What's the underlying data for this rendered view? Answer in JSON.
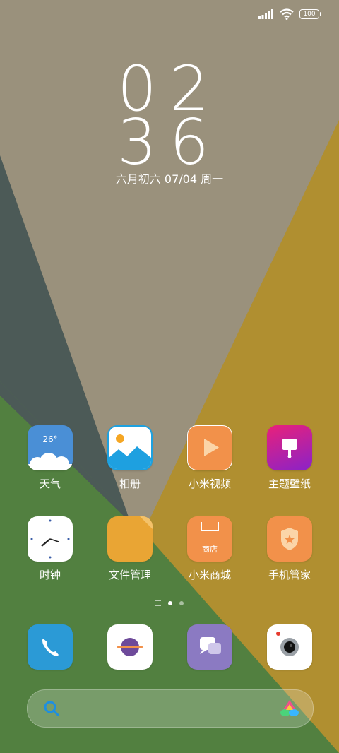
{
  "status_bar": {
    "battery": "100",
    "icons": [
      "signal-icon",
      "wifi-icon",
      "battery-icon"
    ]
  },
  "clock": {
    "hours": "02",
    "minutes": "36",
    "date_line": "六月初六  07/04 周一"
  },
  "apps_row1": [
    {
      "label": "天气",
      "icon": "weather-icon",
      "badge": "26°"
    },
    {
      "label": "相册",
      "icon": "gallery-icon"
    },
    {
      "label": "小米视频",
      "icon": "video-play-icon"
    },
    {
      "label": "主题壁纸",
      "icon": "themes-brush-icon"
    }
  ],
  "apps_row2": [
    {
      "label": "时钟",
      "icon": "clock-icon"
    },
    {
      "label": "文件管理",
      "icon": "folder-icon"
    },
    {
      "label": "小米商城",
      "icon": "store-bag-icon",
      "badge": "商店"
    },
    {
      "label": "手机管家",
      "icon": "security-shield-icon"
    }
  ],
  "dock": [
    {
      "icon": "phone-icon"
    },
    {
      "icon": "browser-planet-icon"
    },
    {
      "icon": "messages-icon"
    },
    {
      "icon": "camera-icon"
    }
  ],
  "pager": {
    "pages": 2,
    "active": 0
  },
  "search": {
    "icons": [
      "search-icon",
      "assistant-icon"
    ]
  },
  "colors": {
    "wallpaper_beige": "#9a917c",
    "wallpaper_gold": "#b08f30",
    "wallpaper_green": "#528040",
    "wallpaper_slate": "#4c5a57"
  }
}
